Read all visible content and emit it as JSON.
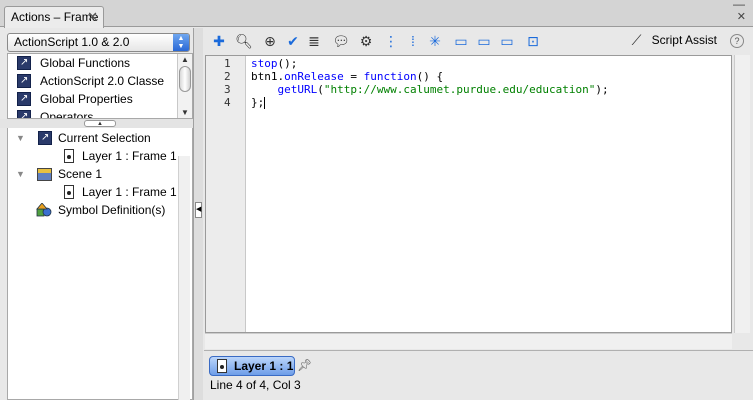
{
  "tab": {
    "title": "Actions – Frame",
    "close": "✕"
  },
  "window": {
    "minimize": "—",
    "close": "✕"
  },
  "left": {
    "dropdown_value": "ActionScript 1.0 & 2.0",
    "library_items": [
      {
        "label": "Global Functions"
      },
      {
        "label": "ActionScript 2.0 Classe"
      },
      {
        "label": "Global Properties"
      },
      {
        "label": "Operators"
      }
    ],
    "tree": {
      "current_selection": "Current Selection",
      "current_frame": "Layer 1 : Frame 1",
      "scene": "Scene 1",
      "scene_frame": "Layer 1 : Frame 1",
      "symbols": "Symbol Definition(s)"
    }
  },
  "toolbar": {
    "script_assist": "Script Assist",
    "help": "?"
  },
  "editor": {
    "lines": [
      {
        "num": "1",
        "a": "stop",
        "b": "();",
        "c": "",
        "d": ""
      },
      {
        "num": "2",
        "a": "btn1.",
        "b": "onRelease",
        "c": " = ",
        "d": "function",
        "e": "() {"
      },
      {
        "num": "3",
        "a": "    ",
        "b": "getURL",
        "c": "(",
        "d": "\"http://www.calumet.purdue.edu/education\"",
        "e": ");"
      },
      {
        "num": "4",
        "a": "};"
      }
    ]
  },
  "bottom": {
    "frame_tab": "Layer 1 : 1",
    "status": "Line 4 of 4, Col 3"
  },
  "colors": {
    "keyword": "#0000ff",
    "string": "#008000",
    "frame_tab": "#6e9de8"
  }
}
